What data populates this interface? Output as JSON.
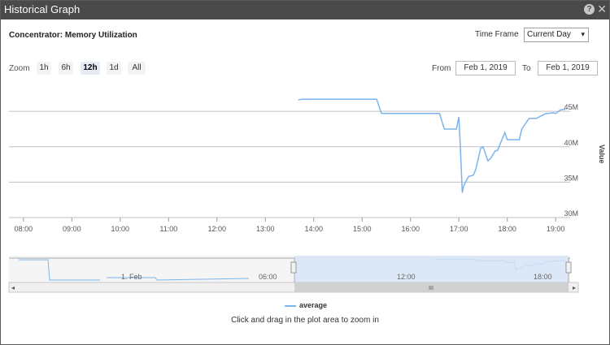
{
  "window": {
    "title": "Historical Graph",
    "help_icon": "question-circle-icon",
    "help_glyph": "?",
    "close_icon": "close-icon",
    "close_glyph": "✕"
  },
  "header": {
    "chart_title": "Concentrator: Memory Utilization",
    "time_frame_label": "Time Frame",
    "time_frame_value": "Current Day"
  },
  "zoom": {
    "label": "Zoom",
    "buttons": [
      "1h",
      "6h",
      "12h",
      "1d",
      "All"
    ],
    "active": "12h"
  },
  "range": {
    "from_label": "From",
    "from_value": "Feb 1, 2019",
    "to_label": "To",
    "to_value": "Feb 1, 2019"
  },
  "colors": {
    "series": "#7cb5ec",
    "navigator_mask": "#d6e4f7",
    "grid": "#c0c0c0"
  },
  "chart_data": {
    "type": "line",
    "ylabel": "Value",
    "y_ticks": [
      "30M",
      "35M",
      "40M",
      "45M"
    ],
    "y_values": [
      30,
      35,
      40,
      45
    ],
    "ylim": [
      30,
      48
    ],
    "x_ticks": [
      "08:00",
      "09:00",
      "10:00",
      "11:00",
      "12:00",
      "13:00",
      "14:00",
      "15:00",
      "16:00",
      "17:00",
      "18:00",
      "19:00"
    ],
    "x_hours": [
      8,
      9,
      10,
      11,
      12,
      13,
      14,
      15,
      16,
      17,
      18,
      19
    ],
    "xlim": [
      7.7,
      19.3
    ],
    "series": [
      {
        "name": "average",
        "x": [
          13.68,
          13.75,
          14.0,
          14.5,
          15.0,
          15.3,
          15.4,
          16.0,
          16.6,
          16.7,
          16.95,
          17.0,
          17.03,
          17.07,
          17.1,
          17.2,
          17.3,
          17.35,
          17.45,
          17.5,
          17.6,
          17.65,
          17.75,
          17.8,
          17.95,
          18.0,
          18.1,
          18.2,
          18.25,
          18.3,
          18.45,
          18.5,
          18.6,
          18.8,
          18.85,
          18.95,
          19.0,
          19.1,
          19.2
        ],
        "y": [
          46.6,
          46.7,
          46.7,
          46.7,
          46.7,
          46.7,
          44.7,
          44.7,
          44.7,
          42.5,
          42.5,
          44.2,
          40.0,
          33.5,
          34.5,
          35.8,
          36.0,
          36.8,
          39.8,
          40.0,
          38.0,
          38.3,
          39.4,
          39.5,
          42.0,
          41.0,
          41.0,
          41.0,
          41.0,
          42.5,
          44.0,
          44.0,
          44.0,
          44.7,
          44.7,
          44.8,
          44.7,
          45.2,
          45.3
        ]
      }
    ],
    "navigator": {
      "x_labels": [
        "1. Feb",
        "06:00",
        "12:00",
        "18:00"
      ],
      "scroll_thumb": "III",
      "left_arrow": "◂",
      "right_arrow": "▸"
    },
    "legend_position": "bottom-center"
  },
  "footer": {
    "hint": "Click and drag in the plot area to zoom in"
  }
}
